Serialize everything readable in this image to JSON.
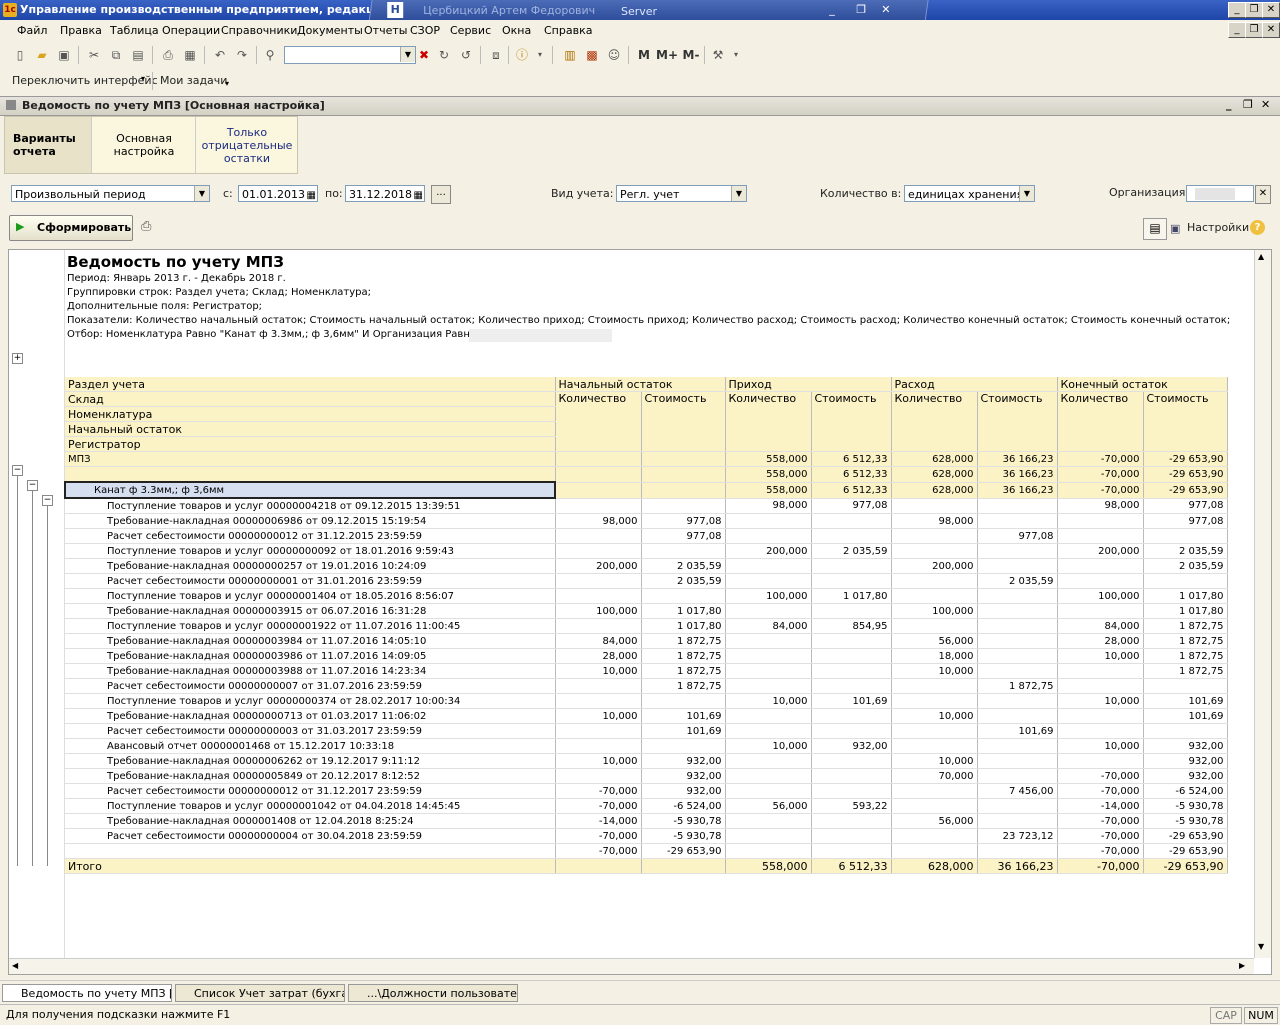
{
  "window": {
    "title": "Управление производственным предприятием, редакция",
    "remote_user": "Цербицкий Артем Федорович",
    "remote_server": "Server"
  },
  "menu": [
    "Файл",
    "Правка",
    "Таблица",
    "Операции",
    "Справочники",
    "Документы",
    "Отчеты",
    "СЗОР",
    "Сервис",
    "Окна",
    "Справка"
  ],
  "toolbar2": {
    "switch_interface": "Переключить интерфейс",
    "my_tasks": "Мои задачи"
  },
  "toolbar_marks": {
    "m": "M",
    "mplus": "M+",
    "mminus": "M-"
  },
  "inner_title": "Ведомость по учету МПЗ [Основная настройка]",
  "variants": {
    "tab1": "Варианты отчета",
    "tab2": "Основная настройка",
    "tab3": "Только отрицательные остатки"
  },
  "params": {
    "period_type": "Произвольный период",
    "from_label": "с:",
    "from_date": "01.01.2013",
    "to_label": "по:",
    "to_date": "31.12.2018",
    "dots": "...",
    "account_type_label": "Вид учета:",
    "account_type": "Регл. учет",
    "qty_label": "Количество в:",
    "qty_unit": "единицах хранения",
    "org_label": "Организация:",
    "generate": "Сформировать",
    "settings": "Настройки"
  },
  "report": {
    "title": "Ведомость по учету МПЗ",
    "lines": [
      "Период: Январь 2013 г. - Декабрь 2018 г.",
      "Группировки строк: Раздел учета; Склад; Номенклатура;",
      "Дополнительные поля: Регистратор;",
      "Показатели: Количество начальный остаток; Стоимость начальный остаток; Количество приход; Стоимость приход; Количество расход; Стоимость расход; Количество конечный остаток; Стоимость конечный остаток;",
      "Отбор: Номенклатура Равно \"Канат ф 3.3мм,; ф 3,6мм\" И Организация Равно"
    ],
    "headers": {
      "group_rows": [
        "Раздел учета",
        "Склад",
        "Номенклатура",
        "Начальный остаток",
        "Регистратор"
      ],
      "start": "Начальный остаток",
      "income": "Приход",
      "expense": "Расход",
      "end": "Конечный остаток",
      "qty": "Количество",
      "cost": "Стоимость"
    },
    "rows": [
      {
        "name": "МПЗ",
        "v": [
          "",
          "",
          "558,000",
          "6 512,33",
          "628,000",
          "36 166,23",
          "-70,000",
          "-29 653,90"
        ]
      },
      {
        "name": "",
        "v": [
          "",
          "",
          "558,000",
          "6 512,33",
          "628,000",
          "36 166,23",
          "-70,000",
          "-29 653,90"
        ]
      },
      {
        "name": "Канат ф 3.3мм,; ф 3,6мм",
        "v": [
          "",
          "",
          "558,000",
          "6 512,33",
          "628,000",
          "36 166,23",
          "-70,000",
          "-29 653,90"
        ]
      },
      {
        "name": "Поступление товаров и услуг 00000004218 от 09.12.2015 13:39:51",
        "v": [
          "",
          "",
          "98,000",
          "977,08",
          "",
          "",
          "98,000",
          "977,08"
        ]
      },
      {
        "name": "Требование-накладная 00000006986 от 09.12.2015 15:19:54",
        "v": [
          "98,000",
          "977,08",
          "",
          "",
          "98,000",
          "",
          "",
          "977,08"
        ]
      },
      {
        "name": "Расчет себестоимости 00000000012 от 31.12.2015 23:59:59",
        "v": [
          "",
          "977,08",
          "",
          "",
          "",
          "977,08",
          "",
          ""
        ]
      },
      {
        "name": "Поступление товаров и услуг 00000000092 от 18.01.2016 9:59:43",
        "v": [
          "",
          "",
          "200,000",
          "2 035,59",
          "",
          "",
          "200,000",
          "2 035,59"
        ]
      },
      {
        "name": "Требование-накладная 00000000257 от 19.01.2016 10:24:09",
        "v": [
          "200,000",
          "2 035,59",
          "",
          "",
          "200,000",
          "",
          "",
          "2 035,59"
        ]
      },
      {
        "name": "Расчет себестоимости 00000000001 от 31.01.2016 23:59:59",
        "v": [
          "",
          "2 035,59",
          "",
          "",
          "",
          "2 035,59",
          "",
          ""
        ]
      },
      {
        "name": "Поступление товаров и услуг 00000001404 от 18.05.2016 8:56:07",
        "v": [
          "",
          "",
          "100,000",
          "1 017,80",
          "",
          "",
          "100,000",
          "1 017,80"
        ]
      },
      {
        "name": "Требование-накладная 00000003915 от 06.07.2016 16:31:28",
        "v": [
          "100,000",
          "1 017,80",
          "",
          "",
          "100,000",
          "",
          "",
          "1 017,80"
        ]
      },
      {
        "name": "Поступление товаров и услуг 00000001922 от 11.07.2016 11:00:45",
        "v": [
          "",
          "1 017,80",
          "84,000",
          "854,95",
          "",
          "",
          "84,000",
          "1 872,75"
        ]
      },
      {
        "name": "Требование-накладная 00000003984 от 11.07.2016 14:05:10",
        "v": [
          "84,000",
          "1 872,75",
          "",
          "",
          "56,000",
          "",
          "28,000",
          "1 872,75"
        ]
      },
      {
        "name": "Требование-накладная 00000003986 от 11.07.2016 14:09:05",
        "v": [
          "28,000",
          "1 872,75",
          "",
          "",
          "18,000",
          "",
          "10,000",
          "1 872,75"
        ]
      },
      {
        "name": "Требование-накладная 00000003988 от 11.07.2016 14:23:34",
        "v": [
          "10,000",
          "1 872,75",
          "",
          "",
          "10,000",
          "",
          "",
          "1 872,75"
        ]
      },
      {
        "name": "Расчет себестоимости 00000000007 от 31.07.2016 23:59:59",
        "v": [
          "",
          "1 872,75",
          "",
          "",
          "",
          "1 872,75",
          "",
          ""
        ]
      },
      {
        "name": "Поступление товаров и услуг 00000000374 от 28.02.2017 10:00:34",
        "v": [
          "",
          "",
          "10,000",
          "101,69",
          "",
          "",
          "10,000",
          "101,69"
        ]
      },
      {
        "name": "Требование-накладная 00000000713 от 01.03.2017 11:06:02",
        "v": [
          "10,000",
          "101,69",
          "",
          "",
          "10,000",
          "",
          "",
          "101,69"
        ]
      },
      {
        "name": "Расчет себестоимости 00000000003 от 31.03.2017 23:59:59",
        "v": [
          "",
          "101,69",
          "",
          "",
          "",
          "101,69",
          "",
          ""
        ]
      },
      {
        "name": "Авансовый отчет 00000001468 от 15.12.2017 10:33:18",
        "v": [
          "",
          "",
          "10,000",
          "932,00",
          "",
          "",
          "10,000",
          "932,00"
        ]
      },
      {
        "name": "Требование-накладная 00000006262 от 19.12.2017 9:11:12",
        "v": [
          "10,000",
          "932,00",
          "",
          "",
          "10,000",
          "",
          "",
          "932,00"
        ]
      },
      {
        "name": "Требование-накладная 00000005849 от 20.12.2017 8:12:52",
        "v": [
          "",
          "932,00",
          "",
          "",
          "70,000",
          "",
          "-70,000",
          "932,00"
        ]
      },
      {
        "name": "Расчет себестоимости 00000000012 от 31.12.2017 23:59:59",
        "v": [
          "-70,000",
          "932,00",
          "",
          "",
          "",
          "7 456,00",
          "-70,000",
          "-6 524,00"
        ]
      },
      {
        "name": "Поступление товаров и услуг 00000001042 от 04.04.2018 14:45:45",
        "v": [
          "-70,000",
          "-6 524,00",
          "56,000",
          "593,22",
          "",
          "",
          "-14,000",
          "-5 930,78"
        ]
      },
      {
        "name": "Требование-накладная 0000001408 от 12.04.2018 8:25:24",
        "v": [
          "-14,000",
          "-5 930,78",
          "",
          "",
          "56,000",
          "",
          "-70,000",
          "-5 930,78"
        ]
      },
      {
        "name": "Расчет себестоимости 00000000004 от 30.04.2018 23:59:59",
        "v": [
          "-70,000",
          "-5 930,78",
          "",
          "",
          "",
          "23 723,12",
          "-70,000",
          "-29 653,90"
        ]
      },
      {
        "name": "",
        "v": [
          "-70,000",
          "-29 653,90",
          "",
          "",
          "",
          "",
          "-70,000",
          "-29 653,90"
        ]
      }
    ],
    "total": {
      "name": "Итого",
      "v": [
        "",
        "",
        "558,000",
        "6 512,33",
        "628,000",
        "36 166,23",
        "-70,000",
        "-29 653,90"
      ]
    }
  },
  "taskbar": [
    "Ведомость по учету МПЗ [О...",
    "Список Учет затрат (бухгал...",
    "...\\Должности пользовател..."
  ],
  "status": {
    "hint": "Для получения подсказки нажмите F1",
    "cap": "CAP",
    "num": "NUM"
  }
}
